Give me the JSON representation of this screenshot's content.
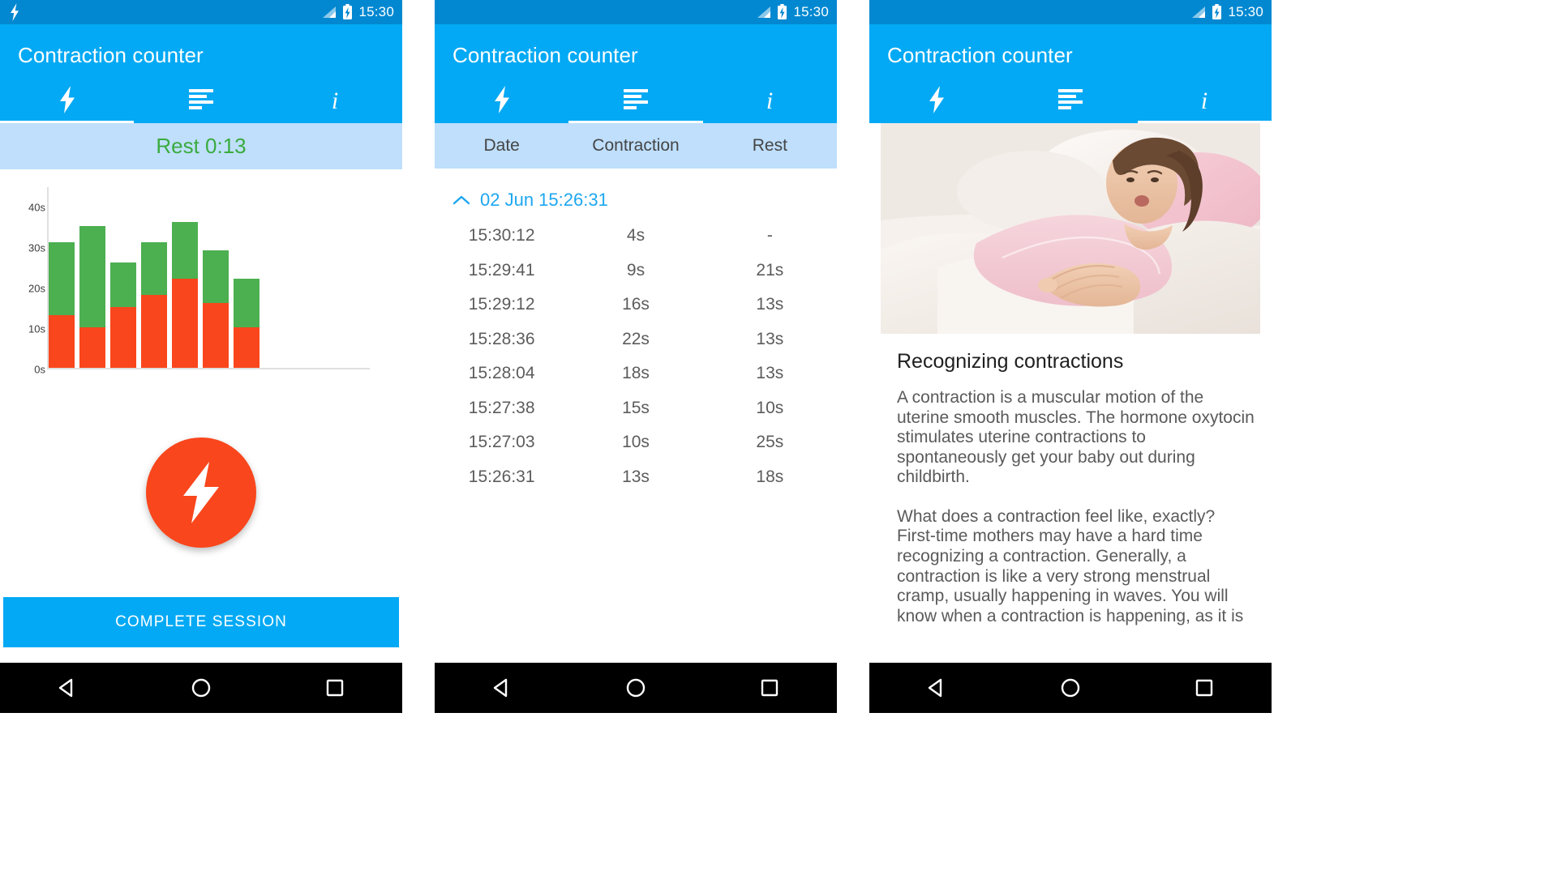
{
  "app": {
    "title": "Contraction counter",
    "colors": {
      "primary": "#03a9f4",
      "primary_dark": "#0288d1",
      "accent_orange": "#f9461c",
      "bar_green": "#4caf50",
      "banner_blue": "#bfdffc",
      "rest_text_green": "#3bab3f",
      "link_blue": "#1ea7f0"
    }
  },
  "status_bar": {
    "time": "15:30",
    "bolt_icon": "bolt-icon",
    "signal_icon": "signal-icon",
    "battery_icon": "battery-charging-icon"
  },
  "tabs": [
    {
      "id": "counter",
      "icon": "bolt-icon",
      "label": "Counter"
    },
    {
      "id": "log",
      "icon": "list-icon",
      "label": "Log"
    },
    {
      "id": "info",
      "icon": "info-icon",
      "label": "Info"
    }
  ],
  "panel1": {
    "active_tab_index": 0,
    "rest_banner": "Rest 0:13",
    "fab_icon": "bolt-icon",
    "cta_label": "COMPLETE SESSION"
  },
  "panel2": {
    "active_tab_index": 1,
    "columns": [
      "Date",
      "Contraction",
      "Rest"
    ],
    "session": {
      "expand_icon": "chevron-up-icon",
      "label": "02 Jun 15:26:31"
    },
    "rows": [
      {
        "date": "15:30:12",
        "contraction": "4s",
        "rest": "-"
      },
      {
        "date": "15:29:41",
        "contraction": "9s",
        "rest": "21s"
      },
      {
        "date": "15:29:12",
        "contraction": "16s",
        "rest": "13s"
      },
      {
        "date": "15:28:36",
        "contraction": "22s",
        "rest": "13s"
      },
      {
        "date": "15:28:04",
        "contraction": "18s",
        "rest": "13s"
      },
      {
        "date": "15:27:38",
        "contraction": "15s",
        "rest": "10s"
      },
      {
        "date": "15:27:03",
        "contraction": "10s",
        "rest": "25s"
      },
      {
        "date": "15:26:31",
        "contraction": "13s",
        "rest": "18s"
      }
    ]
  },
  "panel3": {
    "active_tab_index": 2,
    "hero_image": "pregnant-woman-lying-on-couch-photo",
    "article_title": "Recognizing contractions",
    "paragraphs": [
      "A contraction is a muscular motion of the uterine smooth muscles. The hormone oxytocin stimulates uterine contractions to spontaneously get your baby out during childbirth.",
      "What does a contraction feel like, exactly? First-time mothers may have a hard time recognizing a contraction. Generally, a contraction is like a very strong menstrual cramp, usually happening in waves. You will know when a contraction is happening, as it is"
    ]
  },
  "nav_bar": {
    "back_icon": "triangle-back-icon",
    "home_icon": "circle-home-icon",
    "recents_icon": "square-recents-icon"
  },
  "chart_data": {
    "type": "bar",
    "stacked": true,
    "title": "",
    "xlabel": "",
    "ylabel": "",
    "ylim": [
      0,
      45
    ],
    "yticks": [
      0,
      10,
      20,
      30,
      40
    ],
    "ytick_labels": [
      "0s",
      "10s",
      "20s",
      "30s",
      "40s"
    ],
    "grid": false,
    "legend": "none",
    "categories": [
      "1",
      "2",
      "3",
      "4",
      "5",
      "6",
      "7"
    ],
    "series": [
      {
        "name": "Contraction",
        "color": "#f9461c",
        "values": [
          13,
          10,
          15,
          18,
          22,
          16,
          10
        ]
      },
      {
        "name": "Rest",
        "color": "#4caf50",
        "values": [
          18,
          25,
          11,
          13,
          14,
          13,
          12
        ]
      }
    ],
    "totals": [
      31,
      35,
      26,
      31,
      36,
      29,
      22
    ]
  }
}
